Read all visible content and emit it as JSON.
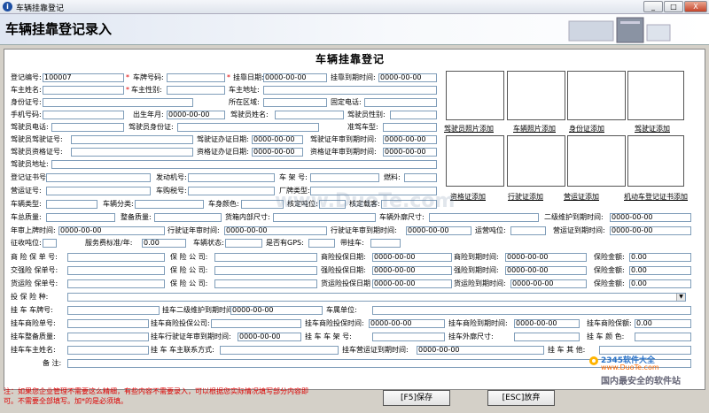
{
  "window": {
    "title": "车辆挂靠登记",
    "min": "_",
    "max": "□",
    "close": "X"
  },
  "header": {
    "title": "车辆挂靠登记录入"
  },
  "form_title": "车辆挂靠登记",
  "labels": {
    "reg_no": "登记编号:",
    "plate": "车牌号码:",
    "date": "挂靠日期:",
    "expire": "挂靠到期时间:",
    "owner_name": "车主姓名:",
    "owner_sex": "车主性别:",
    "owner_addr": "车主地址:",
    "idcard": "身份证号:",
    "region": "所在区域:",
    "phone": "固定电话:",
    "mobile": "手机号码:",
    "birth": "出生年月:",
    "driver_name": "驾驶员姓名:",
    "driver_sex": "驾驶员性别:",
    "driver_phone": "驾驶员电话:",
    "driver_id": "驾驶员身份证:",
    "quasi": "准驾车型:",
    "driver_lic": "驾驶员驾驶证号:",
    "lic_date": "驾驶证办证日期:",
    "lic_exp": "驾驶证年审到期时间:",
    "qual_no": "驾驶员资格证号:",
    "qual_date": "资格证办证日期:",
    "qual_exp": "资格证年审到期时间:",
    "driver_addr": "驾驶员地址:",
    "reg_cert": "登记证书号:",
    "engine": "发动机号:",
    "frame": "车 架 号:",
    "fuel": "燃料:",
    "op_cert": "营运证号:",
    "purchase_tax": "车购税号:",
    "factory_type": "厂牌类型:",
    "vtype": "车辆类型:",
    "vclass": "车辆分类:",
    "color": "车身颜色:",
    "seats": "核定吨位:",
    "load": "核定载客:",
    "total_mass": "车总质量:",
    "curb": "整备质量:",
    "cargo_size": "货箱内部尺寸:",
    "vsize": "车辆外廓尺寸:",
    "maint": "二级维护到期时间:",
    "annual": "年审上牌时间:",
    "review": "行驶证年审时间:",
    "review_exp": "行驶证年审到期时间:",
    "op_ton": "运营吨位:",
    "op_exp": "营运证到期时间:",
    "tax_ton": "征收吨位:",
    "service_fee": "服务费标准/年:",
    "vstate": "车辆状态:",
    "gps": "是否有GPS:",
    "trailer": "带挂车:",
    "ins_no": "商 险 保 单 号:",
    "ins_co": "保 险 公 司:",
    "ins_date": "商险投保日期:",
    "ins_exp": "商险到期时间:",
    "ins_amt": "保险金额:",
    "cmp_no": "交强险 保单号:",
    "cmp_co": "保 险 公 司:",
    "cmp_date": "强险投保日期:",
    "cmp_exp": "强险到期时间:",
    "cmp_amt": "保险金额:",
    "cargo_no": "货运险 保单号:",
    "cargo_co": "保 险 公 司:",
    "cargo_date": "货运险投保日期",
    "cargo_exp": "货运险到期时间:",
    "cargo_amt": "保险金额:",
    "ins_type": "投 保 险 种:",
    "t_plate": "挂 车 车牌号:",
    "t_maint": "挂车二级维护到期时间:",
    "t_unit": "车属单位:",
    "t_ins_no": "挂车商险单号:",
    "t_ins_co": "挂车商险投保公司:",
    "t_ins_date": "挂车商险投保时间:",
    "t_ins_exp": "挂车商险到期时间:",
    "t_ins_amt": "挂车商险保额:",
    "t_curb": "挂车整备质量:",
    "t_review_exp": "挂车行驶证年审到期时间:",
    "t_frame": "挂 车 车 架 号:",
    "t_size": "挂车外廓尺寸:",
    "t_color": "挂 车 颜 色:",
    "t_owner": "挂车车主姓名:",
    "t_contact": "挂 车 车主联系方式:",
    "t_op_exp": "挂车营运证到期时间:",
    "t_other": "挂 车 其 他:",
    "remark": "备 注:"
  },
  "values": {
    "reg_no": "100007",
    "date": "0000-00-00",
    "expire": "0000-00-00",
    "birth": "0000-00-00",
    "lic_date": "0000-00-00",
    "lic_exp": "0000-00-00",
    "qual_date": "0000-00-00",
    "qual_exp": "0000-00-00",
    "maint": "0000-00-00",
    "annual": "0000-00-00",
    "review": "0000-00-00",
    "review_exp": "0000-00-00",
    "op_exp": "0000-00-00",
    "service_fee": "0.00",
    "ins_date": "0000-00-00",
    "ins_exp": "0000-00-00",
    "ins_amt": "0.00",
    "cmp_date": "0000-00-00",
    "cmp_exp": "0000-00-00",
    "cmp_amt": "0.00",
    "cargo_date": "0000-00-00",
    "cargo_exp": "0000-00-00",
    "cargo_amt": "0.00",
    "t_maint": "0000-00-00",
    "t_ins_date": "0000-00-00",
    "t_ins_exp": "0000-00-00",
    "t_ins_amt": "0.00",
    "t_review_exp": "0000-00-00",
    "t_op_exp": "0000-00-00"
  },
  "photos": [
    "驾驶员照片添加",
    "车辆照片添加",
    "身份证添加",
    "驾驶证添加",
    "资格证添加",
    "行驶证添加",
    "营运证添加",
    "机动车登记证书添加"
  ],
  "notes": [
    "注：如果您企业管理不需要这么精细，有些内容不需要录入，可以根据您实际情况填写部分内容即",
    "可。不需要全部填写。加*的是必须填。",
    ""
  ],
  "buttons": {
    "save": "[F5]保存",
    "cancel": "[ESC]放弃"
  },
  "watermark": "www.DuoTe.com",
  "logo": {
    "a": "2345软件大全",
    "b": "www.DuoTe.com",
    "c": "国内最安全的软件站"
  }
}
